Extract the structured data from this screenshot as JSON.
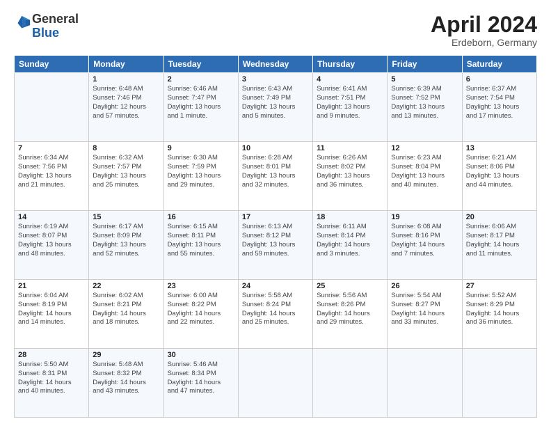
{
  "logo": {
    "general": "General",
    "blue": "Blue"
  },
  "header": {
    "month": "April 2024",
    "location": "Erdeborn, Germany"
  },
  "weekdays": [
    "Sunday",
    "Monday",
    "Tuesday",
    "Wednesday",
    "Thursday",
    "Friday",
    "Saturday"
  ],
  "weeks": [
    [
      {
        "day": "",
        "info": ""
      },
      {
        "day": "1",
        "info": "Sunrise: 6:48 AM\nSunset: 7:46 PM\nDaylight: 12 hours\nand 57 minutes."
      },
      {
        "day": "2",
        "info": "Sunrise: 6:46 AM\nSunset: 7:47 PM\nDaylight: 13 hours\nand 1 minute."
      },
      {
        "day": "3",
        "info": "Sunrise: 6:43 AM\nSunset: 7:49 PM\nDaylight: 13 hours\nand 5 minutes."
      },
      {
        "day": "4",
        "info": "Sunrise: 6:41 AM\nSunset: 7:51 PM\nDaylight: 13 hours\nand 9 minutes."
      },
      {
        "day": "5",
        "info": "Sunrise: 6:39 AM\nSunset: 7:52 PM\nDaylight: 13 hours\nand 13 minutes."
      },
      {
        "day": "6",
        "info": "Sunrise: 6:37 AM\nSunset: 7:54 PM\nDaylight: 13 hours\nand 17 minutes."
      }
    ],
    [
      {
        "day": "7",
        "info": "Sunrise: 6:34 AM\nSunset: 7:56 PM\nDaylight: 13 hours\nand 21 minutes."
      },
      {
        "day": "8",
        "info": "Sunrise: 6:32 AM\nSunset: 7:57 PM\nDaylight: 13 hours\nand 25 minutes."
      },
      {
        "day": "9",
        "info": "Sunrise: 6:30 AM\nSunset: 7:59 PM\nDaylight: 13 hours\nand 29 minutes."
      },
      {
        "day": "10",
        "info": "Sunrise: 6:28 AM\nSunset: 8:01 PM\nDaylight: 13 hours\nand 32 minutes."
      },
      {
        "day": "11",
        "info": "Sunrise: 6:26 AM\nSunset: 8:02 PM\nDaylight: 13 hours\nand 36 minutes."
      },
      {
        "day": "12",
        "info": "Sunrise: 6:23 AM\nSunset: 8:04 PM\nDaylight: 13 hours\nand 40 minutes."
      },
      {
        "day": "13",
        "info": "Sunrise: 6:21 AM\nSunset: 8:06 PM\nDaylight: 13 hours\nand 44 minutes."
      }
    ],
    [
      {
        "day": "14",
        "info": "Sunrise: 6:19 AM\nSunset: 8:07 PM\nDaylight: 13 hours\nand 48 minutes."
      },
      {
        "day": "15",
        "info": "Sunrise: 6:17 AM\nSunset: 8:09 PM\nDaylight: 13 hours\nand 52 minutes."
      },
      {
        "day": "16",
        "info": "Sunrise: 6:15 AM\nSunset: 8:11 PM\nDaylight: 13 hours\nand 55 minutes."
      },
      {
        "day": "17",
        "info": "Sunrise: 6:13 AM\nSunset: 8:12 PM\nDaylight: 13 hours\nand 59 minutes."
      },
      {
        "day": "18",
        "info": "Sunrise: 6:11 AM\nSunset: 8:14 PM\nDaylight: 14 hours\nand 3 minutes."
      },
      {
        "day": "19",
        "info": "Sunrise: 6:08 AM\nSunset: 8:16 PM\nDaylight: 14 hours\nand 7 minutes."
      },
      {
        "day": "20",
        "info": "Sunrise: 6:06 AM\nSunset: 8:17 PM\nDaylight: 14 hours\nand 11 minutes."
      }
    ],
    [
      {
        "day": "21",
        "info": "Sunrise: 6:04 AM\nSunset: 8:19 PM\nDaylight: 14 hours\nand 14 minutes."
      },
      {
        "day": "22",
        "info": "Sunrise: 6:02 AM\nSunset: 8:21 PM\nDaylight: 14 hours\nand 18 minutes."
      },
      {
        "day": "23",
        "info": "Sunrise: 6:00 AM\nSunset: 8:22 PM\nDaylight: 14 hours\nand 22 minutes."
      },
      {
        "day": "24",
        "info": "Sunrise: 5:58 AM\nSunset: 8:24 PM\nDaylight: 14 hours\nand 25 minutes."
      },
      {
        "day": "25",
        "info": "Sunrise: 5:56 AM\nSunset: 8:26 PM\nDaylight: 14 hours\nand 29 minutes."
      },
      {
        "day": "26",
        "info": "Sunrise: 5:54 AM\nSunset: 8:27 PM\nDaylight: 14 hours\nand 33 minutes."
      },
      {
        "day": "27",
        "info": "Sunrise: 5:52 AM\nSunset: 8:29 PM\nDaylight: 14 hours\nand 36 minutes."
      }
    ],
    [
      {
        "day": "28",
        "info": "Sunrise: 5:50 AM\nSunset: 8:31 PM\nDaylight: 14 hours\nand 40 minutes."
      },
      {
        "day": "29",
        "info": "Sunrise: 5:48 AM\nSunset: 8:32 PM\nDaylight: 14 hours\nand 43 minutes."
      },
      {
        "day": "30",
        "info": "Sunrise: 5:46 AM\nSunset: 8:34 PM\nDaylight: 14 hours\nand 47 minutes."
      },
      {
        "day": "",
        "info": ""
      },
      {
        "day": "",
        "info": ""
      },
      {
        "day": "",
        "info": ""
      },
      {
        "day": "",
        "info": ""
      }
    ]
  ]
}
